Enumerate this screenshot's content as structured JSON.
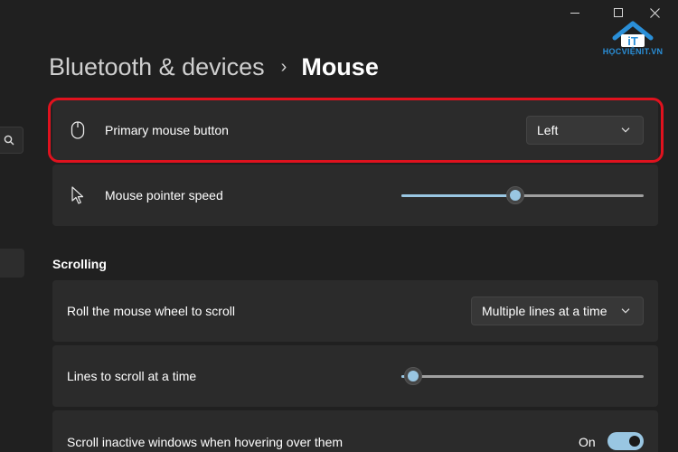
{
  "window": {
    "logo_text": "HỌCVIỆNIT.VN",
    "logo_mark": "iT",
    "logo_color": "#2a8fd8"
  },
  "breadcrumb": {
    "parent": "Bluetooth & devices",
    "separator": "›",
    "current": "Mouse"
  },
  "settings": {
    "primary_button": {
      "label": "Primary mouse button",
      "value": "Left",
      "icon": "mouse-icon"
    },
    "pointer_speed": {
      "label": "Mouse pointer speed",
      "icon": "pointer-icon",
      "level": 0.47
    }
  },
  "scrolling": {
    "title": "Scrolling",
    "roll_wheel": {
      "label": "Roll the mouse wheel to scroll",
      "value": "Multiple lines at a time"
    },
    "lines_at_a_time": {
      "label": "Lines to scroll at a time",
      "level": 0.05
    },
    "inactive_windows": {
      "label": "Scroll inactive windows when hovering over them",
      "state_label": "On",
      "on": true
    }
  },
  "colors": {
    "accent": "#99c6e2",
    "highlight": "#e0121e",
    "card": "#2b2b2b",
    "background": "#202020"
  }
}
